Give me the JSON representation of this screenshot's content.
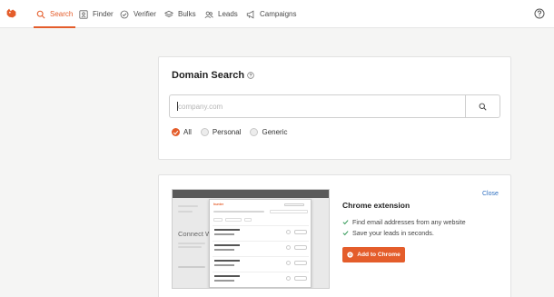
{
  "nav": {
    "items": [
      {
        "label": "Search",
        "icon": "search-icon",
        "active": true
      },
      {
        "label": "Finder",
        "icon": "finder-icon",
        "active": false
      },
      {
        "label": "Verifier",
        "icon": "verifier-icon",
        "active": false
      },
      {
        "label": "Bulks",
        "icon": "bulks-icon",
        "active": false
      },
      {
        "label": "Leads",
        "icon": "leads-icon",
        "active": false
      },
      {
        "label": "Campaigns",
        "icon": "campaigns-icon",
        "active": false
      }
    ],
    "help_icon": "help-icon"
  },
  "domain_search": {
    "title": "Domain Search",
    "placeholder": "company.com",
    "value": "",
    "filters": [
      {
        "label": "All",
        "checked": true
      },
      {
        "label": "Personal",
        "checked": false
      },
      {
        "label": "Generic",
        "checked": false
      }
    ]
  },
  "extension": {
    "close_label": "Close",
    "title": "Chrome extension",
    "features": [
      "Find email addresses from any website",
      "Save your leads in seconds."
    ],
    "button_label": "Add to Chrome",
    "preview": {
      "brand": "hunter",
      "bg_heading": "Connect W"
    }
  },
  "colors": {
    "accent": "#e45d2b",
    "link": "#2e6fc0",
    "check": "#3a9d5d"
  }
}
